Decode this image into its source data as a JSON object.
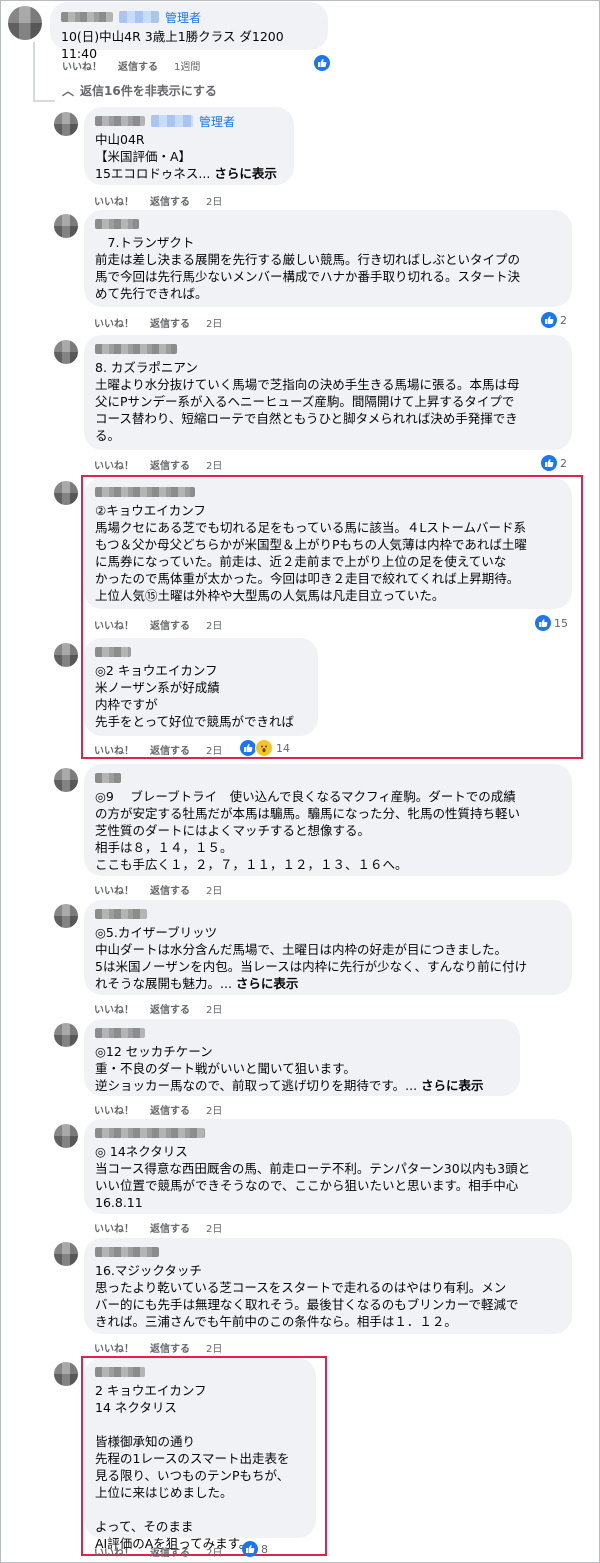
{
  "top": {
    "admin_label": "管理者",
    "text": "10(日)中山4R 3歳上1勝クラス ダ1200 11:40",
    "actions": {
      "like": "いいね！",
      "reply": "返信する",
      "time": "1週間"
    }
  },
  "hide_replies": "返信16件を非表示にする",
  "comments": [
    {
      "admin_label": "管理者",
      "text": "中山04R\n【米国評価・A】\n15エコロドゥネス... ",
      "more": "さらに表示",
      "like": "いいね！",
      "reply": "返信する",
      "time": "2日"
    },
    {
      "text": "　7.トランザクト\n前走は差し決まる展開を先行する厳しい競馬。行き切ればしぶといタイプの\n馬で今回は先行馬少ないメンバー構成でハナか番手取り切れる。スタート決\nめて先行できれば。",
      "like": "いいね！",
      "reply": "返信する",
      "time": "2日",
      "reactions": "2"
    },
    {
      "text": "8. カズラポニアン\n土曜より水分抜けていく馬場で芝指向の決め手生きる馬場に張る。本馬は母\n父にPサンデー系が入るヘニーヒューズ産駒。間隔開けて上昇するタイプで\nコース替わり、短縮ローテで自然ともうひと脚タメられれば決め手発揮でき\nる。",
      "like": "いいね！",
      "reply": "返信する",
      "time": "2日",
      "reactions": "2"
    },
    {
      "text": "②キョウエイカンフ\n馬場クセにある芝でも切れる足をもっている馬に該当。４Lストームバード系\nもつ＆父か母父どちらかが米国型＆上がりPもちの人気薄は内枠であれば土曜\nに馬券になっていた。前走は、近２走前まで上がり上位の足を使えていな\nかったので馬体重が太かった。今回は叩き２走目で絞れてくれば上昇期待。\n上位人気⑮土曜は外枠や大型馬の人気馬は凡走目立っていた。",
      "like": "いいね！",
      "reply": "返信する",
      "time": "2日",
      "reactions": "15"
    },
    {
      "text": "◎2 キョウエイカンフ\n米ノーザン系が好成績\n内枠ですが\n先手をとって好位で競馬ができれば",
      "like": "いいね！",
      "reply": "返信する",
      "time": "2日",
      "reactions": "14"
    },
    {
      "text": "◎9　 ブレーブトライ　使い込んで良くなるマクフィ産駒。ダートでの成績\nの方が安定する牡馬だが本馬は騸馬。騸馬になった分、牝馬の性質持ち軽い\n芝性質のダートにはよくマッチすると想像する。\n相手は８，１４，１５。\nここも手広く１，２，７，１１，１２，１３、１６へ。",
      "like": "いいね！",
      "reply": "返信する",
      "time": "2日"
    },
    {
      "text": "◎5.カイザーブリッツ\n中山ダートは水分含んだ馬場で、土曜日は内枠の好走が目につきました。\n5は米国ノーザンを内包。当レースは内枠に先行が少なく、すんなり前に付け\nれそうな展開も魅力。... ",
      "more": "さらに表示",
      "like": "いいね！",
      "reply": "返信する",
      "time": "2日"
    },
    {
      "text": "◎12 セッカチケーン\n重・不良のダート戦がいいと聞いて狙います。\n逆ショッカー馬なので、前取って逃げ切りを期待です。... ",
      "more": "さらに表示",
      "like": "いいね！",
      "reply": "返信する",
      "time": "2日"
    },
    {
      "text": "◎ 14ネクタリス\n当コース得意な西田厩舎の馬、前走ローテ不利。テンパターン30以内も3頭と\nいい位置で競馬ができそうなので、ここから狙いたいと思います。相手中心\n16.8.11",
      "like": "いいね！",
      "reply": "返信する",
      "time": "2日"
    },
    {
      "text": "16.マジックタッチ\n思ったより乾いている芝コースをスタートで走れるのはやはり有利。メン\nバー的にも先手は無理なく取れそう。最後甘くなるのもブリンカーで軽減で\nきれば。三浦さんでも午前中のこの条件なら。相手は１．１２。",
      "like": "いいね！",
      "reply": "返信する",
      "time": "2日"
    },
    {
      "text": "2 キョウエイカンフ\n14 ネクタリス\n\n皆様御承知の通り\n先程の1レースのスマート出走表を\n見る限り、いつものテンPもちが、\n上位に来はじめました。\n\nよって、そのまま\nAI評価のAを狙ってみます。",
      "like": "いいね！",
      "reply": "返信する",
      "time": "2日",
      "reactions": "8"
    }
  ],
  "colors": {
    "accent": "#1877f2",
    "highlight": "#e0234b",
    "bubble": "#f0f2f5"
  }
}
